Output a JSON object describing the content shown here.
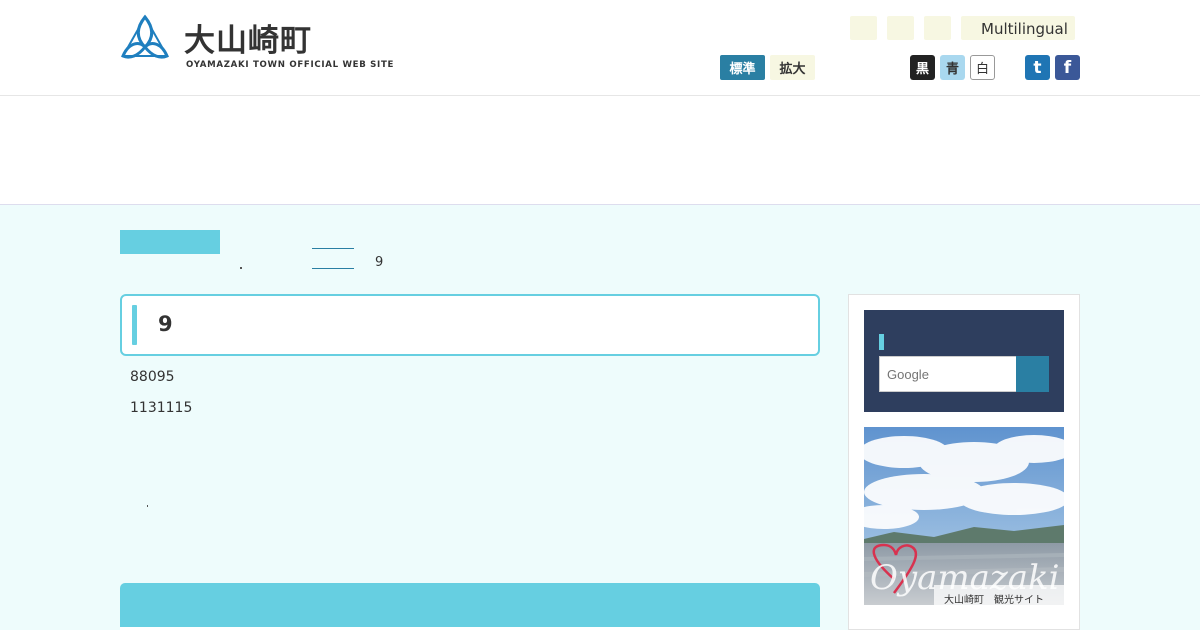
{
  "header": {
    "logo_jp": "大山崎町",
    "logo_en": "OYAMAZAKI TOWN OFFICIAL WEB SITE",
    "multilingual_label": "Multilingual",
    "font_size": {
      "standard_label": "標準",
      "large_label": "拡大"
    },
    "color_theme": {
      "black_label": "黒",
      "blue_label": "青",
      "white_label": "白"
    },
    "sns": {
      "twitter_label": "t",
      "facebook_label": "f"
    }
  },
  "breadcrumb": {
    "current": "9"
  },
  "page": {
    "title": "9",
    "lines": [
      "88095",
      "1131115"
    ]
  },
  "sidebar": {
    "search": {
      "placeholder": "Google"
    },
    "tour_banner": {
      "caption": "大山崎町　観光サイト",
      "script_text": "Oyamazaki"
    }
  },
  "colors": {
    "accent_cyan": "#66cfe1",
    "accent_blue": "#2a7fa3",
    "navy": "#2e3e5e",
    "page_bg": "#eefcfc"
  }
}
